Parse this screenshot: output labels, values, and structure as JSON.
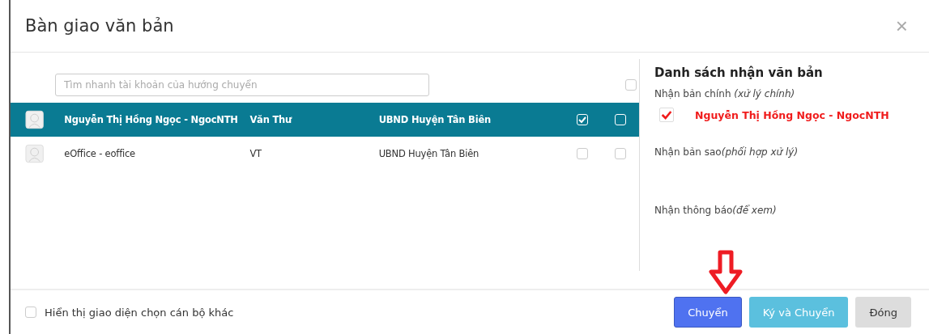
{
  "dialog": {
    "title": "Bàn giao văn bản",
    "close": "×"
  },
  "search": {
    "placeholder": "Tìm nhanh tài khoản của hướng chuyển"
  },
  "header_checkbox": {
    "checked": false
  },
  "rows": [
    {
      "name": "Nguyễn Thị Hồng Ngọc - NgocNTH",
      "role": "Văn Thư",
      "unit": "UBND Huyện Tân Biên",
      "selected": true,
      "main_checked": true,
      "copy_checked": false
    },
    {
      "name": "eOffice - eoffice",
      "role": "VT",
      "unit": "UBND Huyện Tân Biên",
      "selected": false,
      "main_checked": false,
      "copy_checked": false
    }
  ],
  "recipients_panel": {
    "title": "Danh sách nhận văn bản",
    "groups": [
      {
        "label": "Nhận bản chính",
        "note": "(xử lý chính)",
        "recipients": [
          {
            "name": "Nguyễn Thị Hồng Ngọc - NgocNTH",
            "checked": true
          }
        ]
      },
      {
        "label": "Nhận bản sao",
        "note": "(phối hợp xử lý)"
      },
      {
        "label": "Nhận thông báo",
        "note": "(để xem)"
      }
    ]
  },
  "footer": {
    "option": {
      "label": "Hiển thị giao diện chọn cán bộ khác",
      "checked": false
    },
    "buttons": [
      {
        "label": "Chuyển",
        "kind": "primary"
      },
      {
        "label": "Ký và Chuyển",
        "kind": "info"
      },
      {
        "label": "Đóng",
        "kind": "default"
      }
    ]
  }
}
